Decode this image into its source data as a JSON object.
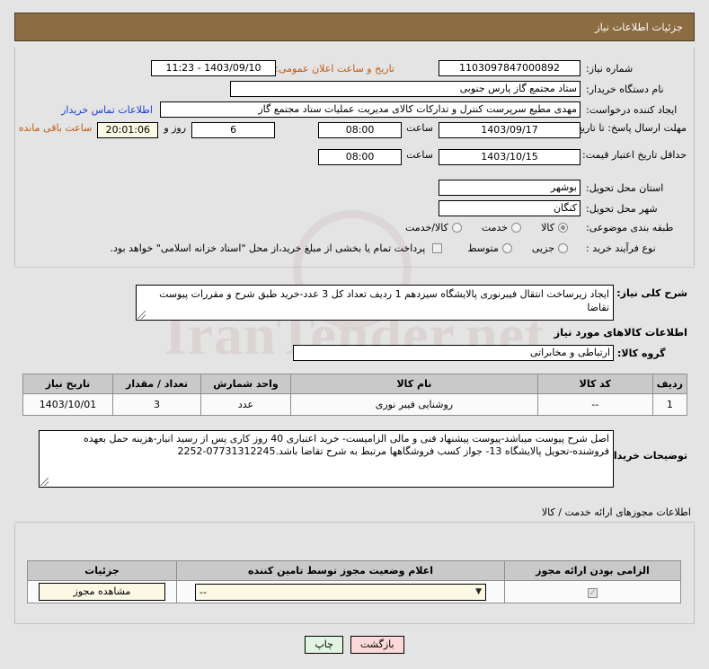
{
  "header": {
    "title": "جزئیات اطلاعات نیاز"
  },
  "watermark": {
    "text": "IranTender.net",
    "mark": "@"
  },
  "form": {
    "need_number_label": "شماره نیاز:",
    "need_number_value": "1103097847000892",
    "announce_label": "تاریخ و ساعت اعلان عمومی:",
    "announce_value": "1403/09/10 - 11:23",
    "buyer_org_label": "نام دستگاه خریدار:",
    "buyer_org_value": "ستاد مجتمع گاز پارس جنوبی",
    "creator_label": "ایجاد کننده درخواست:",
    "creator_value": "مهدی مطیع سرپرست کنترل و تدارکات کالای مدیریت عملیات ستاد مجتمع گاز",
    "contact_link": "اطلاعات تماس خریدار",
    "deadline_label": "مهلت ارسال پاسخ: تا تاریخ:",
    "deadline_date": "1403/09/17",
    "hour_label": "ساعت",
    "deadline_time": "08:00",
    "days_value": "6",
    "days_label": "روز و",
    "remaining_time": "20:01:06",
    "remaining_label": "ساعت باقی مانده",
    "validity_label": "حداقل تاریخ اعتبار قیمت: تا تاریخ:",
    "validity_date": "1403/10/15",
    "validity_time": "08:00",
    "province_label": "استان محل تحویل:",
    "province_value": "بوشهر",
    "city_label": "شهر محل تحویل:",
    "city_value": "کنگان",
    "category_label": "طبقه بندی موضوعی:",
    "category_options": [
      "کالا",
      "خدمت",
      "کالا/خدمت"
    ],
    "category_selected": 0,
    "process_label": "نوع فرآیند خرید :",
    "process_options": [
      "جزیی",
      "متوسط"
    ],
    "process_selected": -1,
    "treasury_note": "پرداخت تمام یا بخشی از مبلغ خرید،از محل \"اسناد خزانه اسلامی\" خواهد بود."
  },
  "summary": {
    "label": "شرح کلی نیاز:",
    "value": "ایجاد زیرساخت انتقال فیبرنوری پالایشگاه سیزدهم  1 ردیف تعداد کل 3 عدد-خرید طبق شرح و مقررات پیوست تقاضا"
  },
  "goods_section": {
    "title": "اطلاعات کالاهای مورد نیاز",
    "group_label": "گروه کالا:",
    "group_value": "ارتباطی و مخابراتی",
    "columns": [
      "ردیف",
      "کد کالا",
      "نام کالا",
      "واحد شمارش",
      "تعداد / مقدار",
      "تاریخ نیاز"
    ],
    "rows": [
      [
        "1",
        "--",
        "روشنایی فیبر نوری",
        "عدد",
        "3",
        "1403/10/01"
      ]
    ]
  },
  "buyer_notes": {
    "label": "توضیحات خریدار:",
    "value": "اصل شرح پیوست میباشد-پیوست پیشنهاد فنی و مالی الزامیست- خرید اعتباری 40 روز کاری پس از رسید انبار-هزینه حمل بعهده فروشنده-تحویل پالایشگاه 13- جواز کسب فروشگاهها مرتبط به شرح تقاضا باشد.07731312245-2252"
  },
  "permits_section": {
    "title": "اطلاعات مجوزهای ارائه خدمت / کالا",
    "columns": [
      "الزامی بودن ارائه مجوز",
      "اعلام وضعیت مجوز توسط تامین کننده",
      "جزئیات"
    ],
    "required_checked": true,
    "status_value": "--",
    "details_button": "مشاهده مجوز"
  },
  "footer": {
    "print_label": "چاپ",
    "back_label": "بازگشت"
  }
}
